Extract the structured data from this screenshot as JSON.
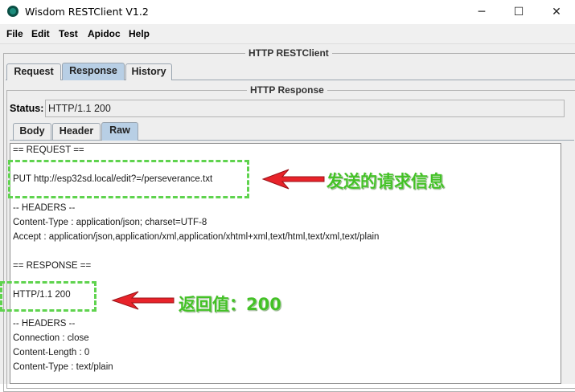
{
  "window": {
    "title": "Wisdom RESTClient V1.2",
    "controls": {
      "minimize": "─",
      "maximize": "☐",
      "close": "✕"
    }
  },
  "menu": {
    "items": [
      "File",
      "Edit",
      "Test",
      "Apidoc",
      "Help"
    ]
  },
  "main_panel": {
    "title": "HTTP RESTClient"
  },
  "main_tabs": {
    "items": [
      "Request",
      "Response",
      "History"
    ],
    "selected": "Response"
  },
  "response_panel": {
    "title": "HTTP Response",
    "status_label": "Status:",
    "status_value": "HTTP/1.1 200"
  },
  "sub_tabs": {
    "items": [
      "Body",
      "Header",
      "Raw"
    ],
    "selected": "Raw"
  },
  "raw": {
    "lines": [
      "== REQUEST ==",
      "PUT http://esp32sd.local/edit?=/perseverance.txt",
      "-- HEADERS --",
      "Content-Type : application/json; charset=UTF-8",
      "Accept : application/json,application/xml,application/xhtml+xml,text/html,text/xml,text/plain",
      "== RESPONSE ==",
      "HTTP/1.1 200",
      "-- HEADERS --",
      "Connection : close",
      "Content-Length : 0",
      "Content-Type : text/plain"
    ]
  },
  "annotations": {
    "request_note": "发送的请求信息",
    "response_note": "返回值：200",
    "highlight_color": "#5fd34e",
    "arrow_color": "#e8232a",
    "text_color": "#43c126"
  }
}
